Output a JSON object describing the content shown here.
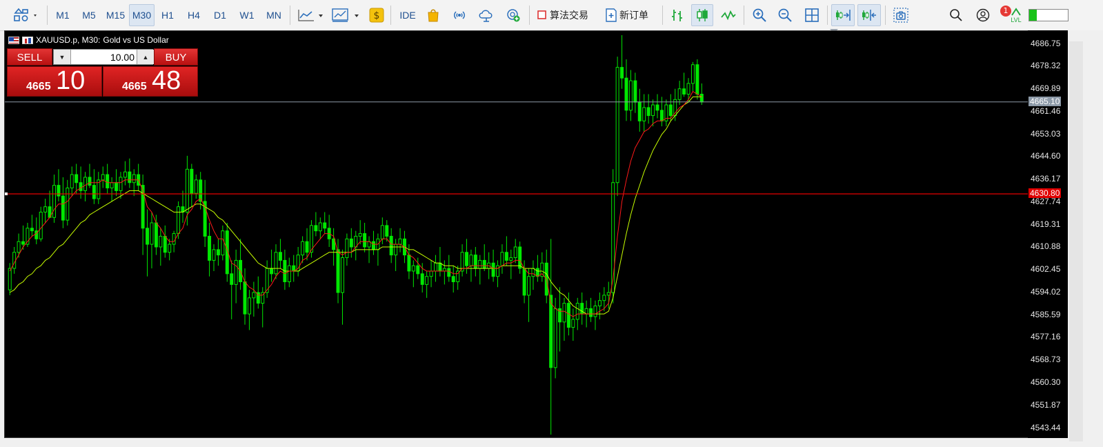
{
  "toolbar": {
    "timeframes": [
      "M1",
      "M5",
      "M15",
      "M30",
      "H1",
      "H4",
      "D1",
      "W1",
      "MN"
    ],
    "active_timeframe": "M30",
    "ide_label": "IDE",
    "algo_trading_label": "算法交易",
    "new_order_label": "新订单",
    "notifications_count": "1",
    "level_label": "LVL",
    "level_fill_fraction": 0.2
  },
  "chart": {
    "symbol": "XAUUSD.p, M30:",
    "description": "Gold vs US Dollar",
    "price_axis": [
      "4686.75",
      "4678.32",
      "4669.89",
      "4661.46",
      "4653.03",
      "4644.60",
      "4636.17",
      "4627.74",
      "4619.31",
      "4610.88",
      "4602.45",
      "4594.02",
      "4585.59",
      "4577.16",
      "4568.73",
      "4560.30",
      "4551.87",
      "4543.44"
    ],
    "bid_tag": "4665.10",
    "line_tag": "4630.80"
  },
  "trade": {
    "sell_label": "SELL",
    "buy_label": "BUY",
    "volume": "10.00",
    "sell_price_small": "4665",
    "sell_price_big": "10",
    "buy_price_small": "4665",
    "buy_price_big": "48"
  },
  "colors": {
    "bull": "#00e800",
    "bear": "#00e800",
    "ma_fast": "#ff1a1a",
    "ma_slow": "#c7ff00",
    "hline": "#ff0000",
    "bidline": "#8d9aa8"
  },
  "chart_data": {
    "type": "candlestick",
    "ylim": [
      4541.0,
      4690.0
    ],
    "candles_ohlc": [
      [
        4595.0,
        4605.0,
        4593.0,
        4603.0
      ],
      [
        4603.0,
        4611.0,
        4601.0,
        4609.0
      ],
      [
        4609.0,
        4616.0,
        4607.0,
        4613.0
      ],
      [
        4613.0,
        4619.0,
        4610.0,
        4612.0
      ],
      [
        4612.0,
        4620.0,
        4611.0,
        4618.0
      ],
      [
        4618.0,
        4623.0,
        4615.0,
        4617.0
      ],
      [
        4617.0,
        4622.0,
        4612.0,
        4614.0
      ],
      [
        4614.0,
        4626.0,
        4613.0,
        4624.0
      ],
      [
        4624.0,
        4629.0,
        4620.0,
        4626.0
      ],
      [
        4626.0,
        4632.0,
        4623.0,
        4622.0
      ],
      [
        4622.0,
        4638.0,
        4620.0,
        4634.0
      ],
      [
        4634.0,
        4640.0,
        4628.0,
        4630.0
      ],
      [
        4630.0,
        4637.0,
        4618.0,
        4621.0
      ],
      [
        4621.0,
        4636.0,
        4619.0,
        4633.0
      ],
      [
        4633.0,
        4641.0,
        4630.0,
        4638.0
      ],
      [
        4638.0,
        4642.0,
        4631.0,
        4635.0
      ],
      [
        4635.0,
        4641.0,
        4629.0,
        4632.0
      ],
      [
        4632.0,
        4639.0,
        4628.0,
        4637.0
      ],
      [
        4637.0,
        4642.0,
        4633.0,
        4634.0
      ],
      [
        4634.0,
        4640.0,
        4627.0,
        4629.0
      ],
      [
        4629.0,
        4639.0,
        4627.0,
        4636.0
      ],
      [
        4636.0,
        4641.0,
        4633.0,
        4638.0
      ],
      [
        4638.0,
        4642.0,
        4631.0,
        4633.0
      ],
      [
        4633.0,
        4637.0,
        4628.0,
        4635.0
      ],
      [
        4635.0,
        4640.0,
        4630.0,
        4632.0
      ],
      [
        4632.0,
        4639.0,
        4629.0,
        4637.0
      ],
      [
        4637.0,
        4643.0,
        4634.0,
        4639.0
      ],
      [
        4639.0,
        4644.0,
        4633.0,
        4635.0
      ],
      [
        4635.0,
        4640.0,
        4630.0,
        4638.0
      ],
      [
        4638.0,
        4642.0,
        4632.0,
        4634.0
      ],
      [
        4634.0,
        4638.0,
        4608.0,
        4618.0
      ],
      [
        4618.0,
        4625.0,
        4600.0,
        4612.0
      ],
      [
        4612.0,
        4624.0,
        4603.0,
        4620.0
      ],
      [
        4620.0,
        4623.0,
        4608.0,
        4611.0
      ],
      [
        4611.0,
        4618.0,
        4604.0,
        4615.0
      ],
      [
        4615.0,
        4619.0,
        4607.0,
        4609.0
      ],
      [
        4609.0,
        4614.0,
        4606.0,
        4612.0
      ],
      [
        4612.0,
        4617.0,
        4609.0,
        4616.0
      ],
      [
        4616.0,
        4628.0,
        4614.0,
        4626.0
      ],
      [
        4626.0,
        4632.0,
        4620.0,
        4624.0
      ],
      [
        4624.0,
        4645.0,
        4619.0,
        4640.0
      ],
      [
        4640.0,
        4642.0,
        4626.0,
        4631.0
      ],
      [
        4631.0,
        4638.0,
        4629.0,
        4636.0
      ],
      [
        4636.0,
        4639.0,
        4625.0,
        4628.0
      ],
      [
        4628.0,
        4636.0,
        4611.0,
        4615.0
      ],
      [
        4615.0,
        4620.0,
        4600.0,
        4606.0
      ],
      [
        4606.0,
        4612.0,
        4602.0,
        4610.0
      ],
      [
        4610.0,
        4614.0,
        4604.0,
        4608.0
      ],
      [
        4608.0,
        4619.0,
        4606.0,
        4617.0
      ],
      [
        4617.0,
        4620.0,
        4598.0,
        4601.0
      ],
      [
        4601.0,
        4606.0,
        4584.0,
        4597.0
      ],
      [
        4597.0,
        4610.0,
        4590.0,
        4606.0
      ],
      [
        4606.0,
        4614.0,
        4595.0,
        4598.0
      ],
      [
        4598.0,
        4603.0,
        4582.0,
        4586.0
      ],
      [
        4586.0,
        4595.0,
        4580.0,
        4592.0
      ],
      [
        4592.0,
        4598.0,
        4585.0,
        4594.0
      ],
      [
        4594.0,
        4600.0,
        4588.0,
        4590.0
      ],
      [
        4590.0,
        4596.0,
        4581.0,
        4594.0
      ],
      [
        4594.0,
        4606.0,
        4592.0,
        4603.0
      ],
      [
        4603.0,
        4610.0,
        4598.0,
        4601.0
      ],
      [
        4601.0,
        4612.0,
        4599.0,
        4609.0
      ],
      [
        4609.0,
        4614.0,
        4603.0,
        4606.0
      ],
      [
        4606.0,
        4610.0,
        4595.0,
        4598.0
      ],
      [
        4598.0,
        4607.0,
        4596.0,
        4604.0
      ],
      [
        4604.0,
        4608.0,
        4598.0,
        4602.0
      ],
      [
        4602.0,
        4611.0,
        4600.0,
        4608.0
      ],
      [
        4608.0,
        4615.0,
        4605.0,
        4613.0
      ],
      [
        4613.0,
        4618.0,
        4606.0,
        4609.0
      ],
      [
        4609.0,
        4621.0,
        4607.0,
        4619.0
      ],
      [
        4619.0,
        4624.0,
        4615.0,
        4617.0
      ],
      [
        4617.0,
        4622.0,
        4614.0,
        4620.0
      ],
      [
        4620.0,
        4624.0,
        4616.0,
        4618.0
      ],
      [
        4618.0,
        4623.0,
        4611.0,
        4614.0
      ],
      [
        4614.0,
        4618.0,
        4604.0,
        4610.0
      ],
      [
        4610.0,
        4614.0,
        4590.0,
        4594.0
      ],
      [
        4594.0,
        4610.0,
        4582.0,
        4607.0
      ],
      [
        4607.0,
        4616.0,
        4604.0,
        4614.0
      ],
      [
        4614.0,
        4618.0,
        4607.0,
        4611.0
      ],
      [
        4611.0,
        4617.0,
        4606.0,
        4615.0
      ],
      [
        4615.0,
        4621.0,
        4612.0,
        4616.0
      ],
      [
        4616.0,
        4620.0,
        4609.0,
        4611.0
      ],
      [
        4611.0,
        4615.0,
        4605.0,
        4613.0
      ],
      [
        4613.0,
        4617.0,
        4608.0,
        4610.0
      ],
      [
        4610.0,
        4616.0,
        4604.0,
        4614.0
      ],
      [
        4614.0,
        4622.0,
        4612.0,
        4619.0
      ],
      [
        4619.0,
        4621.0,
        4613.0,
        4615.0
      ],
      [
        4615.0,
        4618.0,
        4605.0,
        4608.0
      ],
      [
        4608.0,
        4614.0,
        4602.0,
        4612.0
      ],
      [
        4612.0,
        4618.0,
        4609.0,
        4614.0
      ],
      [
        4614.0,
        4617.0,
        4605.0,
        4608.0
      ],
      [
        4608.0,
        4612.0,
        4599.0,
        4602.0
      ],
      [
        4602.0,
        4606.0,
        4596.0,
        4604.0
      ],
      [
        4604.0,
        4607.0,
        4599.0,
        4601.0
      ],
      [
        4601.0,
        4605.0,
        4594.0,
        4597.0
      ],
      [
        4597.0,
        4602.0,
        4592.0,
        4600.0
      ],
      [
        4600.0,
        4606.0,
        4596.0,
        4602.0
      ],
      [
        4602.0,
        4608.0,
        4598.0,
        4605.0
      ],
      [
        4605.0,
        4611.0,
        4600.0,
        4602.0
      ],
      [
        4602.0,
        4606.0,
        4597.0,
        4603.0
      ],
      [
        4603.0,
        4608.0,
        4598.0,
        4600.0
      ],
      [
        4600.0,
        4604.0,
        4594.0,
        4598.0
      ],
      [
        4598.0,
        4604.0,
        4595.0,
        4602.0
      ],
      [
        4602.0,
        4612.0,
        4600.0,
        4609.0
      ],
      [
        4609.0,
        4614.0,
        4601.0,
        4604.0
      ],
      [
        4604.0,
        4610.0,
        4598.0,
        4608.0
      ],
      [
        4608.0,
        4611.0,
        4600.0,
        4603.0
      ],
      [
        4603.0,
        4608.0,
        4597.0,
        4606.0
      ],
      [
        4606.0,
        4612.0,
        4602.0,
        4603.0
      ],
      [
        4603.0,
        4609.0,
        4599.0,
        4605.0
      ],
      [
        4605.0,
        4610.0,
        4598.0,
        4600.0
      ],
      [
        4600.0,
        4606.0,
        4596.0,
        4604.0
      ],
      [
        4604.0,
        4612.0,
        4601.0,
        4609.0
      ],
      [
        4609.0,
        4615.0,
        4604.0,
        4606.0
      ],
      [
        4606.0,
        4610.0,
        4599.0,
        4607.0
      ],
      [
        4607.0,
        4614.0,
        4605.0,
        4611.0
      ],
      [
        4611.0,
        4613.0,
        4601.0,
        4603.0
      ],
      [
        4603.0,
        4606.0,
        4590.0,
        4593.0
      ],
      [
        4593.0,
        4603.0,
        4583.0,
        4600.0
      ],
      [
        4600.0,
        4606.0,
        4595.0,
        4603.0
      ],
      [
        4603.0,
        4608.0,
        4598.0,
        4600.0
      ],
      [
        4600.0,
        4609.0,
        4598.0,
        4605.0
      ],
      [
        4605.0,
        4610.0,
        4590.0,
        4593.0
      ],
      [
        4593.0,
        4614.0,
        4541.0,
        4566.0
      ],
      [
        4566.0,
        4592.0,
        4562.0,
        4588.0
      ],
      [
        4588.0,
        4596.0,
        4572.0,
        4583.0
      ],
      [
        4583.0,
        4592.0,
        4576.0,
        4590.0
      ],
      [
        4590.0,
        4594.0,
        4578.0,
        4581.0
      ],
      [
        4581.0,
        4588.0,
        4576.0,
        4584.0
      ],
      [
        4584.0,
        4592.0,
        4580.0,
        4590.0
      ],
      [
        4590.0,
        4594.0,
        4582.0,
        4586.0
      ],
      [
        4586.0,
        4591.0,
        4581.0,
        4588.0
      ],
      [
        4588.0,
        4592.0,
        4583.0,
        4585.0
      ],
      [
        4585.0,
        4591.0,
        4580.0,
        4589.0
      ],
      [
        4589.0,
        4594.0,
        4584.0,
        4591.0
      ],
      [
        4591.0,
        4596.0,
        4587.0,
        4593.0
      ],
      [
        4593.0,
        4598.0,
        4588.0,
        4594.0
      ],
      [
        4594.0,
        4640.0,
        4590.0,
        4635.0
      ],
      [
        4635.0,
        4682.0,
        4630.0,
        4678.0
      ],
      [
        4678.0,
        4690.0,
        4670.0,
        4674.0
      ],
      [
        4674.0,
        4681.0,
        4658.0,
        4662.0
      ],
      [
        4662.0,
        4677.0,
        4658.0,
        4673.0
      ],
      [
        4673.0,
        4676.0,
        4661.0,
        4665.0
      ],
      [
        4665.0,
        4670.0,
        4654.0,
        4658.0
      ],
      [
        4658.0,
        4668.0,
        4654.0,
        4663.0
      ],
      [
        4663.0,
        4668.0,
        4657.0,
        4660.0
      ],
      [
        4660.0,
        4666.0,
        4656.0,
        4664.0
      ],
      [
        4664.0,
        4668.0,
        4659.0,
        4662.0
      ],
      [
        4662.0,
        4667.0,
        4656.0,
        4658.0
      ],
      [
        4658.0,
        4666.0,
        4656.0,
        4664.0
      ],
      [
        4664.0,
        4668.0,
        4658.0,
        4660.0
      ],
      [
        4660.0,
        4670.0,
        4658.0,
        4666.0
      ],
      [
        4666.0,
        4673.0,
        4664.0,
        4670.0
      ],
      [
        4670.0,
        4676.0,
        4667.0,
        4668.0
      ],
      [
        4668.0,
        4674.0,
        4665.0,
        4672.0
      ],
      [
        4672.0,
        4680.0,
        4669.0,
        4679.0
      ],
      [
        4679.0,
        4681.0,
        4666.0,
        4668.0
      ],
      [
        4668.0,
        4672.0,
        4664.0,
        4665.1
      ]
    ],
    "ma_fast": [
      4602,
      4605,
      4608,
      4611,
      4613,
      4615,
      4616,
      4618,
      4620,
      4622,
      4625,
      4627,
      4627,
      4628,
      4630,
      4632,
      4633,
      4634,
      4635,
      4635,
      4635,
      4636,
      4635,
      4635,
      4635,
      4635,
      4636,
      4636,
      4636,
      4636,
      4632,
      4626,
      4624,
      4620,
      4618,
      4615,
      4613,
      4613,
      4616,
      4618,
      4623,
      4625,
      4628,
      4629,
      4626,
      4621,
      4617,
      4614,
      4614,
      4610,
      4605,
      4604,
      4602,
      4598,
      4596,
      4595,
      4593,
      4593,
      4595,
      4597,
      4600,
      4602,
      4601,
      4602,
      4602,
      4603,
      4606,
      4607,
      4610,
      4612,
      4614,
      4616,
      4616,
      4615,
      4609,
      4608,
      4609,
      4609,
      4611,
      4613,
      4613,
      4613,
      4612,
      4612,
      4614,
      4614,
      4612,
      4612,
      4612,
      4611,
      4608,
      4607,
      4605,
      4603,
      4602,
      4602,
      4602,
      4602,
      4602,
      4602,
      4601,
      4601,
      4603,
      4603,
      4604,
      4604,
      4604,
      4604,
      4604,
      4603,
      4603,
      4604,
      4605,
      4605,
      4606,
      4606,
      4603,
      4601,
      4601,
      4600,
      4601,
      4599,
      4590,
      4588,
      4587,
      4587,
      4586,
      4585,
      4586,
      4586,
      4586,
      4586,
      4586,
      4587,
      4588,
      4590,
      4599,
      4615,
      4628,
      4636,
      4643,
      4648,
      4651,
      4654,
      4655,
      4657,
      4658,
      4658,
      4659,
      4659,
      4661,
      4663,
      4664,
      4666,
      4669,
      4668,
      4667
    ],
    "ma_slow": [
      4594,
      4595,
      4597,
      4598,
      4600,
      4601,
      4603,
      4604,
      4606,
      4607,
      4609,
      4611,
      4612,
      4614,
      4616,
      4618,
      4620,
      4621,
      4623,
      4624,
      4625,
      4626,
      4627,
      4628,
      4629,
      4630,
      4631,
      4632,
      4632,
      4632,
      4631,
      4630,
      4629,
      4628,
      4627,
      4626,
      4625,
      4624,
      4624,
      4624,
      4625,
      4626,
      4627,
      4627,
      4626,
      4625,
      4624,
      4622,
      4621,
      4619,
      4617,
      4615,
      4613,
      4611,
      4609,
      4607,
      4605,
      4604,
      4603,
      4603,
      4603,
      4603,
      4602,
      4602,
      4602,
      4602,
      4603,
      4604,
      4605,
      4606,
      4607,
      4608,
      4609,
      4609,
      4609,
      4609,
      4609,
      4609,
      4610,
      4610,
      4610,
      4610,
      4610,
      4610,
      4611,
      4611,
      4611,
      4611,
      4611,
      4611,
      4610,
      4610,
      4609,
      4608,
      4607,
      4606,
      4605,
      4605,
      4604,
      4604,
      4604,
      4603,
      4603,
      4603,
      4603,
      4603,
      4603,
      4603,
      4603,
      4603,
      4603,
      4604,
      4604,
      4604,
      4604,
      4604,
      4603,
      4603,
      4603,
      4602,
      4602,
      4601,
      4598,
      4596,
      4594,
      4593,
      4591,
      4589,
      4588,
      4587,
      4586,
      4586,
      4586,
      4586,
      4586,
      4587,
      4592,
      4600,
      4608,
      4616,
      4623,
      4629,
      4634,
      4639,
      4643,
      4647,
      4650,
      4653,
      4655,
      4658,
      4660,
      4662,
      4664,
      4665,
      4667,
      4667,
      4667
    ],
    "hline": 4630.8,
    "bid": 4665.1
  }
}
